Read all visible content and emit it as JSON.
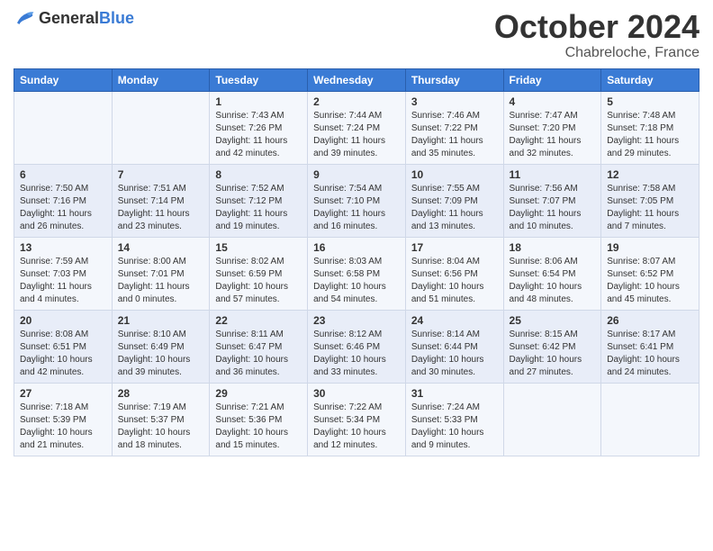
{
  "header": {
    "logo_general": "General",
    "logo_blue": "Blue",
    "title": "October 2024",
    "location": "Chabreloche, France"
  },
  "days_of_week": [
    "Sunday",
    "Monday",
    "Tuesday",
    "Wednesday",
    "Thursday",
    "Friday",
    "Saturday"
  ],
  "weeks": [
    [
      {
        "day": "",
        "sunrise": "",
        "sunset": "",
        "daylight": ""
      },
      {
        "day": "",
        "sunrise": "",
        "sunset": "",
        "daylight": ""
      },
      {
        "day": "1",
        "sunrise": "Sunrise: 7:43 AM",
        "sunset": "Sunset: 7:26 PM",
        "daylight": "Daylight: 11 hours and 42 minutes."
      },
      {
        "day": "2",
        "sunrise": "Sunrise: 7:44 AM",
        "sunset": "Sunset: 7:24 PM",
        "daylight": "Daylight: 11 hours and 39 minutes."
      },
      {
        "day": "3",
        "sunrise": "Sunrise: 7:46 AM",
        "sunset": "Sunset: 7:22 PM",
        "daylight": "Daylight: 11 hours and 35 minutes."
      },
      {
        "day": "4",
        "sunrise": "Sunrise: 7:47 AM",
        "sunset": "Sunset: 7:20 PM",
        "daylight": "Daylight: 11 hours and 32 minutes."
      },
      {
        "day": "5",
        "sunrise": "Sunrise: 7:48 AM",
        "sunset": "Sunset: 7:18 PM",
        "daylight": "Daylight: 11 hours and 29 minutes."
      }
    ],
    [
      {
        "day": "6",
        "sunrise": "Sunrise: 7:50 AM",
        "sunset": "Sunset: 7:16 PM",
        "daylight": "Daylight: 11 hours and 26 minutes."
      },
      {
        "day": "7",
        "sunrise": "Sunrise: 7:51 AM",
        "sunset": "Sunset: 7:14 PM",
        "daylight": "Daylight: 11 hours and 23 minutes."
      },
      {
        "day": "8",
        "sunrise": "Sunrise: 7:52 AM",
        "sunset": "Sunset: 7:12 PM",
        "daylight": "Daylight: 11 hours and 19 minutes."
      },
      {
        "day": "9",
        "sunrise": "Sunrise: 7:54 AM",
        "sunset": "Sunset: 7:10 PM",
        "daylight": "Daylight: 11 hours and 16 minutes."
      },
      {
        "day": "10",
        "sunrise": "Sunrise: 7:55 AM",
        "sunset": "Sunset: 7:09 PM",
        "daylight": "Daylight: 11 hours and 13 minutes."
      },
      {
        "day": "11",
        "sunrise": "Sunrise: 7:56 AM",
        "sunset": "Sunset: 7:07 PM",
        "daylight": "Daylight: 11 hours and 10 minutes."
      },
      {
        "day": "12",
        "sunrise": "Sunrise: 7:58 AM",
        "sunset": "Sunset: 7:05 PM",
        "daylight": "Daylight: 11 hours and 7 minutes."
      }
    ],
    [
      {
        "day": "13",
        "sunrise": "Sunrise: 7:59 AM",
        "sunset": "Sunset: 7:03 PM",
        "daylight": "Daylight: 11 hours and 4 minutes."
      },
      {
        "day": "14",
        "sunrise": "Sunrise: 8:00 AM",
        "sunset": "Sunset: 7:01 PM",
        "daylight": "Daylight: 11 hours and 0 minutes."
      },
      {
        "day": "15",
        "sunrise": "Sunrise: 8:02 AM",
        "sunset": "Sunset: 6:59 PM",
        "daylight": "Daylight: 10 hours and 57 minutes."
      },
      {
        "day": "16",
        "sunrise": "Sunrise: 8:03 AM",
        "sunset": "Sunset: 6:58 PM",
        "daylight": "Daylight: 10 hours and 54 minutes."
      },
      {
        "day": "17",
        "sunrise": "Sunrise: 8:04 AM",
        "sunset": "Sunset: 6:56 PM",
        "daylight": "Daylight: 10 hours and 51 minutes."
      },
      {
        "day": "18",
        "sunrise": "Sunrise: 8:06 AM",
        "sunset": "Sunset: 6:54 PM",
        "daylight": "Daylight: 10 hours and 48 minutes."
      },
      {
        "day": "19",
        "sunrise": "Sunrise: 8:07 AM",
        "sunset": "Sunset: 6:52 PM",
        "daylight": "Daylight: 10 hours and 45 minutes."
      }
    ],
    [
      {
        "day": "20",
        "sunrise": "Sunrise: 8:08 AM",
        "sunset": "Sunset: 6:51 PM",
        "daylight": "Daylight: 10 hours and 42 minutes."
      },
      {
        "day": "21",
        "sunrise": "Sunrise: 8:10 AM",
        "sunset": "Sunset: 6:49 PM",
        "daylight": "Daylight: 10 hours and 39 minutes."
      },
      {
        "day": "22",
        "sunrise": "Sunrise: 8:11 AM",
        "sunset": "Sunset: 6:47 PM",
        "daylight": "Daylight: 10 hours and 36 minutes."
      },
      {
        "day": "23",
        "sunrise": "Sunrise: 8:12 AM",
        "sunset": "Sunset: 6:46 PM",
        "daylight": "Daylight: 10 hours and 33 minutes."
      },
      {
        "day": "24",
        "sunrise": "Sunrise: 8:14 AM",
        "sunset": "Sunset: 6:44 PM",
        "daylight": "Daylight: 10 hours and 30 minutes."
      },
      {
        "day": "25",
        "sunrise": "Sunrise: 8:15 AM",
        "sunset": "Sunset: 6:42 PM",
        "daylight": "Daylight: 10 hours and 27 minutes."
      },
      {
        "day": "26",
        "sunrise": "Sunrise: 8:17 AM",
        "sunset": "Sunset: 6:41 PM",
        "daylight": "Daylight: 10 hours and 24 minutes."
      }
    ],
    [
      {
        "day": "27",
        "sunrise": "Sunrise: 7:18 AM",
        "sunset": "Sunset: 5:39 PM",
        "daylight": "Daylight: 10 hours and 21 minutes."
      },
      {
        "day": "28",
        "sunrise": "Sunrise: 7:19 AM",
        "sunset": "Sunset: 5:37 PM",
        "daylight": "Daylight: 10 hours and 18 minutes."
      },
      {
        "day": "29",
        "sunrise": "Sunrise: 7:21 AM",
        "sunset": "Sunset: 5:36 PM",
        "daylight": "Daylight: 10 hours and 15 minutes."
      },
      {
        "day": "30",
        "sunrise": "Sunrise: 7:22 AM",
        "sunset": "Sunset: 5:34 PM",
        "daylight": "Daylight: 10 hours and 12 minutes."
      },
      {
        "day": "31",
        "sunrise": "Sunrise: 7:24 AM",
        "sunset": "Sunset: 5:33 PM",
        "daylight": "Daylight: 10 hours and 9 minutes."
      },
      {
        "day": "",
        "sunrise": "",
        "sunset": "",
        "daylight": ""
      },
      {
        "day": "",
        "sunrise": "",
        "sunset": "",
        "daylight": ""
      }
    ]
  ]
}
